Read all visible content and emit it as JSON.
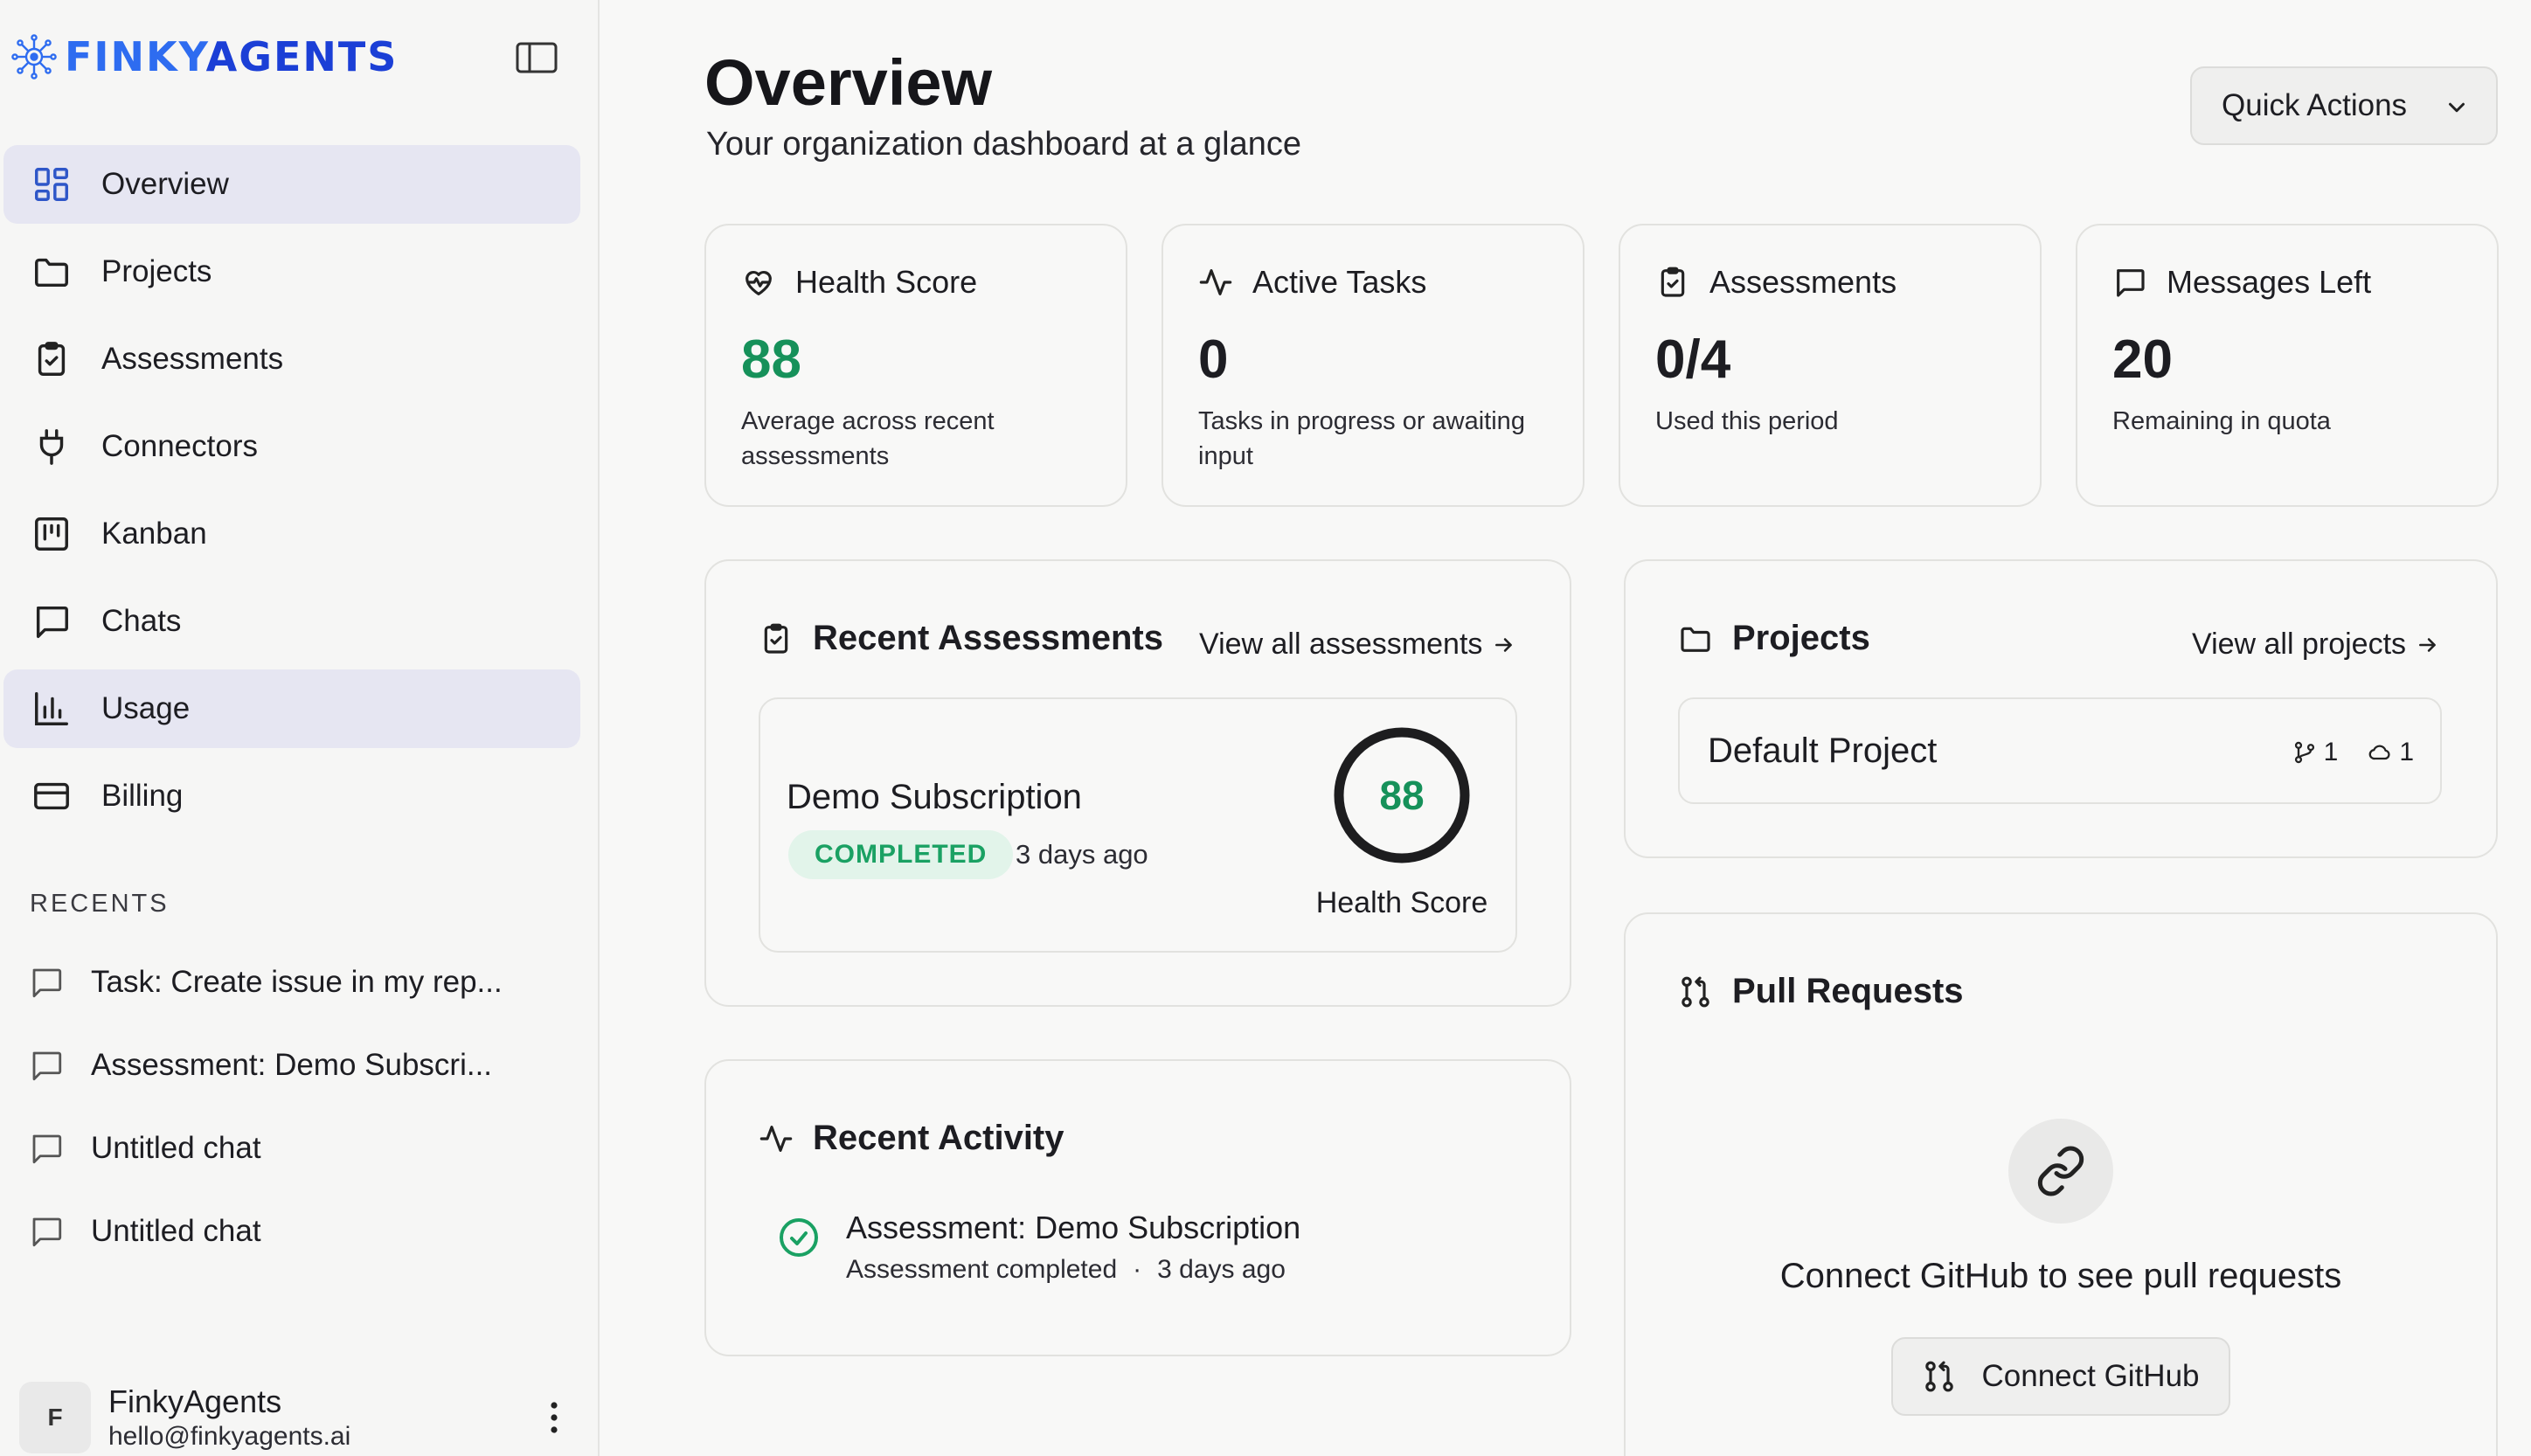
{
  "brand": {
    "name_part1": "FINKY",
    "name_part2": "AGENTS"
  },
  "sidebar": {
    "nav": [
      {
        "label": "Overview",
        "icon": "grid-icon",
        "active": true
      },
      {
        "label": "Projects",
        "icon": "folder-icon"
      },
      {
        "label": "Assessments",
        "icon": "clipboard-check-icon"
      },
      {
        "label": "Connectors",
        "icon": "plug-icon"
      },
      {
        "label": "Kanban",
        "icon": "kanban-icon"
      },
      {
        "label": "Chats",
        "icon": "message-square-icon"
      },
      {
        "label": "Usage",
        "icon": "bar-chart-icon",
        "active": true
      },
      {
        "label": "Billing",
        "icon": "credit-card-icon"
      }
    ],
    "recents_title": "RECENTS",
    "recents": [
      {
        "label": "Task: Create issue in my rep..."
      },
      {
        "label": "Assessment: Demo Subscri..."
      },
      {
        "label": "Untitled chat"
      },
      {
        "label": "Untitled chat"
      }
    ],
    "user": {
      "initial": "F",
      "name": "FinkyAgents",
      "email": "hello@finkyagents.ai"
    }
  },
  "header": {
    "title": "Overview",
    "subtitle": "Your organization dashboard at a glance",
    "quick_actions_label": "Quick Actions"
  },
  "stats": [
    {
      "label": "Health Score",
      "value": "88",
      "desc": "Average across recent assessments",
      "icon": "heart-pulse-icon",
      "accent": "#16915a"
    },
    {
      "label": "Active Tasks",
      "value": "0",
      "desc": "Tasks in progress or awaiting input",
      "icon": "activity-icon"
    },
    {
      "label": "Assessments",
      "value": "0/4",
      "desc": "Used this period",
      "icon": "clipboard-check-icon"
    },
    {
      "label": "Messages Left",
      "value": "20",
      "desc": "Remaining in quota",
      "icon": "message-square-icon"
    }
  ],
  "recent_assessments": {
    "title": "Recent Assessments",
    "link": "View all assessments",
    "item": {
      "title": "Demo Subscription",
      "status": "COMPLETED",
      "time": "3 days ago",
      "score": "88",
      "score_fraction": 1.0,
      "score_label": "Health Score"
    }
  },
  "recent_activity": {
    "title": "Recent Activity",
    "item": {
      "title": "Assessment: Demo Subscription",
      "detail": "Assessment completed",
      "separator": "·",
      "time": "3 days ago"
    }
  },
  "projects": {
    "title": "Projects",
    "link": "View all projects",
    "item": {
      "name": "Default Project",
      "branches": "1",
      "clouds": "1"
    }
  },
  "pull_requests": {
    "title": "Pull Requests",
    "empty_text": "Connect GitHub to see pull requests",
    "button_label": "Connect GitHub"
  },
  "colors": {
    "accent_green": "#16915a",
    "badge_bg": "#e2f4ea",
    "active_nav": "#e6e6f2",
    "brand_blue": "#2e6cf0"
  }
}
